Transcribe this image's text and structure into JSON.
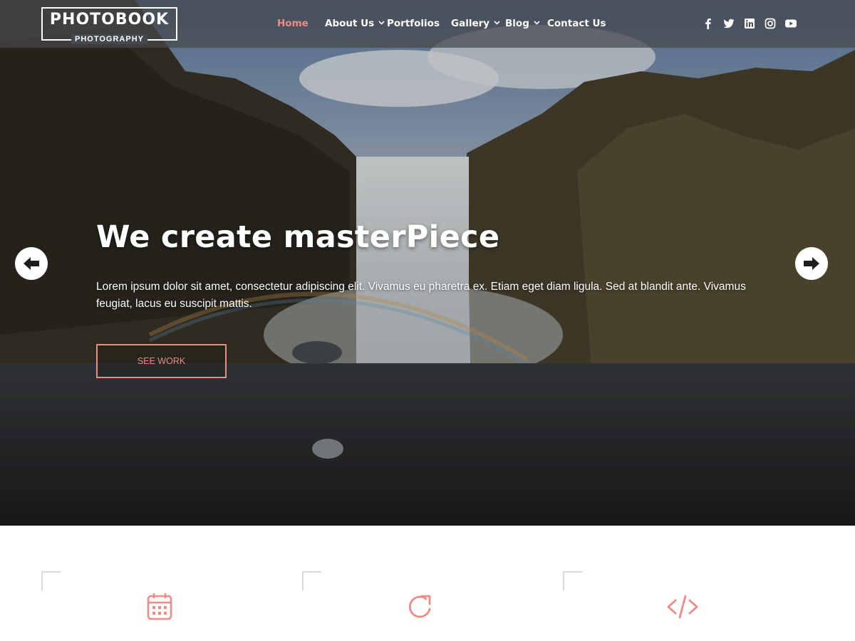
{
  "brand": {
    "title": "PHOTOBOOK",
    "subtitle": "PHOTOGRAPHY"
  },
  "nav": [
    {
      "label": "Home",
      "active": true,
      "dropdown": false
    },
    {
      "label": "About Us",
      "active": false,
      "dropdown": true
    },
    {
      "label": "Portfolios",
      "active": false,
      "dropdown": false
    },
    {
      "label": "Gallery",
      "active": false,
      "dropdown": true
    },
    {
      "label": "Blog",
      "active": false,
      "dropdown": true
    },
    {
      "label": "Contact Us",
      "active": false,
      "dropdown": false
    }
  ],
  "social": [
    "facebook-icon",
    "twitter-icon",
    "linkedin-icon",
    "instagram-icon",
    "youtube-icon"
  ],
  "hero": {
    "title": "We create masterPiece",
    "text": "Lorem ipsum dolor sit amet, consectetur adipiscing elit. Vivamus eu pharetra ex. Etiam eget diam ligula. Sed at blandit ante. Vivamus feugiat, lacus eu suscipit mattis.",
    "button_label": "SEE WORK",
    "prev_icon": "arrow-left-icon",
    "next_icon": "arrow-right-icon"
  },
  "features": [
    {
      "icon": "calendar-icon"
    },
    {
      "icon": "refresh-icon"
    },
    {
      "icon": "code-icon"
    }
  ],
  "colors": {
    "accent": "#f08a86",
    "header_bg": "#46484c",
    "text_light": "#ffffff",
    "corner_line": "#d9d9d9"
  }
}
